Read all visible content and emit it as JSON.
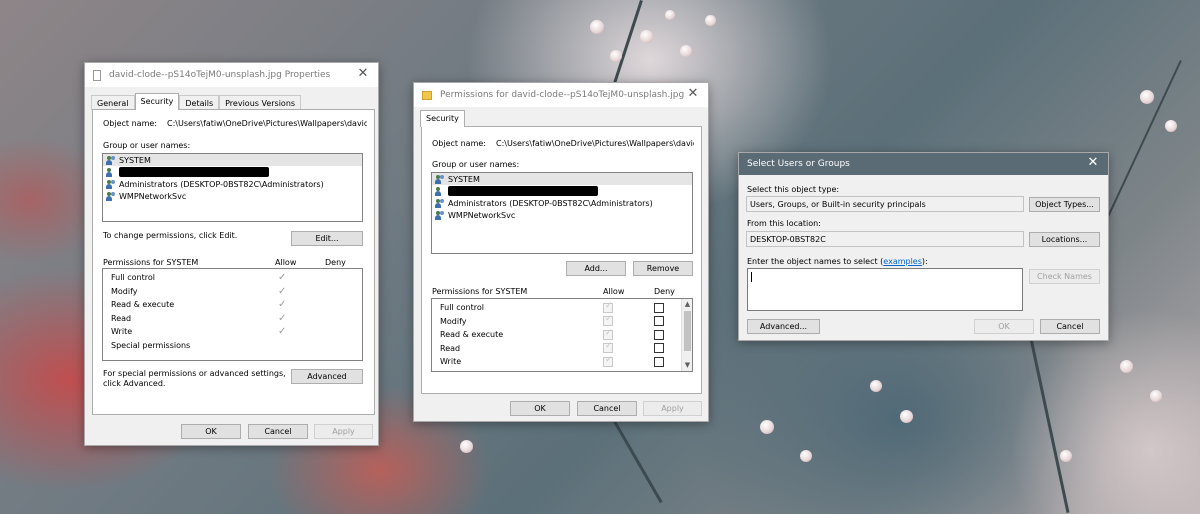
{
  "properties": {
    "title": "david-clode--pS14oTejM0-unsplash.jpg Properties",
    "tabs": [
      "General",
      "Security",
      "Details",
      "Previous Versions"
    ],
    "object_name_label": "Object name:",
    "object_name_value": "C:\\Users\\fatiw\\OneDrive\\Pictures\\Wallpapers\\david-cl",
    "group_label": "Group or user names:",
    "users": [
      "SYSTEM",
      "",
      "Administrators (DESKTOP-0BST82C\\Administrators)",
      "WMPNetworkSvc"
    ],
    "change_hint": "To change permissions, click Edit.",
    "edit_label": "Edit...",
    "perms_for": "Permissions for SYSTEM",
    "allow_label": "Allow",
    "deny_label": "Deny",
    "perms": [
      "Full control",
      "Modify",
      "Read & execute",
      "Read",
      "Write",
      "Special permissions"
    ],
    "advanced_hint_1": "For special permissions or advanced settings,",
    "advanced_hint_2": "click Advanced.",
    "advanced_label": "Advanced",
    "ok_label": "OK",
    "cancel_label": "Cancel",
    "apply_label": "Apply"
  },
  "permissions_dialog": {
    "title": "Permissions for david-clode--pS14oTejM0-unsplash.jpg",
    "tab": "Security",
    "object_name_label": "Object name:",
    "object_name_value": "C:\\Users\\fatiw\\OneDrive\\Pictures\\Wallpapers\\david-cl",
    "group_label": "Group or user names:",
    "users": [
      "SYSTEM",
      "",
      "Administrators (DESKTOP-0BST82C\\Administrators)",
      "WMPNetworkSvc"
    ],
    "add_label": "Add...",
    "remove_label": "Remove",
    "perms_for": "Permissions for SYSTEM",
    "allow_label": "Allow",
    "deny_label": "Deny",
    "perms": [
      "Full control",
      "Modify",
      "Read & execute",
      "Read",
      "Write"
    ],
    "ok_label": "OK",
    "cancel_label": "Cancel",
    "apply_label": "Apply"
  },
  "select_users": {
    "title": "Select Users or Groups",
    "object_type_label": "Select this object type:",
    "object_type_value": "Users, Groups, or Built-in security principals",
    "object_types_label": "Object Types...",
    "location_label": "From this location:",
    "location_value": "DESKTOP-0BST82C",
    "locations_label": "Locations...",
    "enter_label_prefix": "Enter the object names to select (",
    "examples_link": "examples",
    "enter_label_suffix": "):",
    "check_names_label": "Check Names",
    "advanced_label": "Advanced...",
    "ok_label": "OK",
    "cancel_label": "Cancel"
  },
  "colors": {
    "dialog_bg": "#f0f0f0",
    "titlebar_bg": "#ffffff",
    "link": "#0066cc"
  }
}
